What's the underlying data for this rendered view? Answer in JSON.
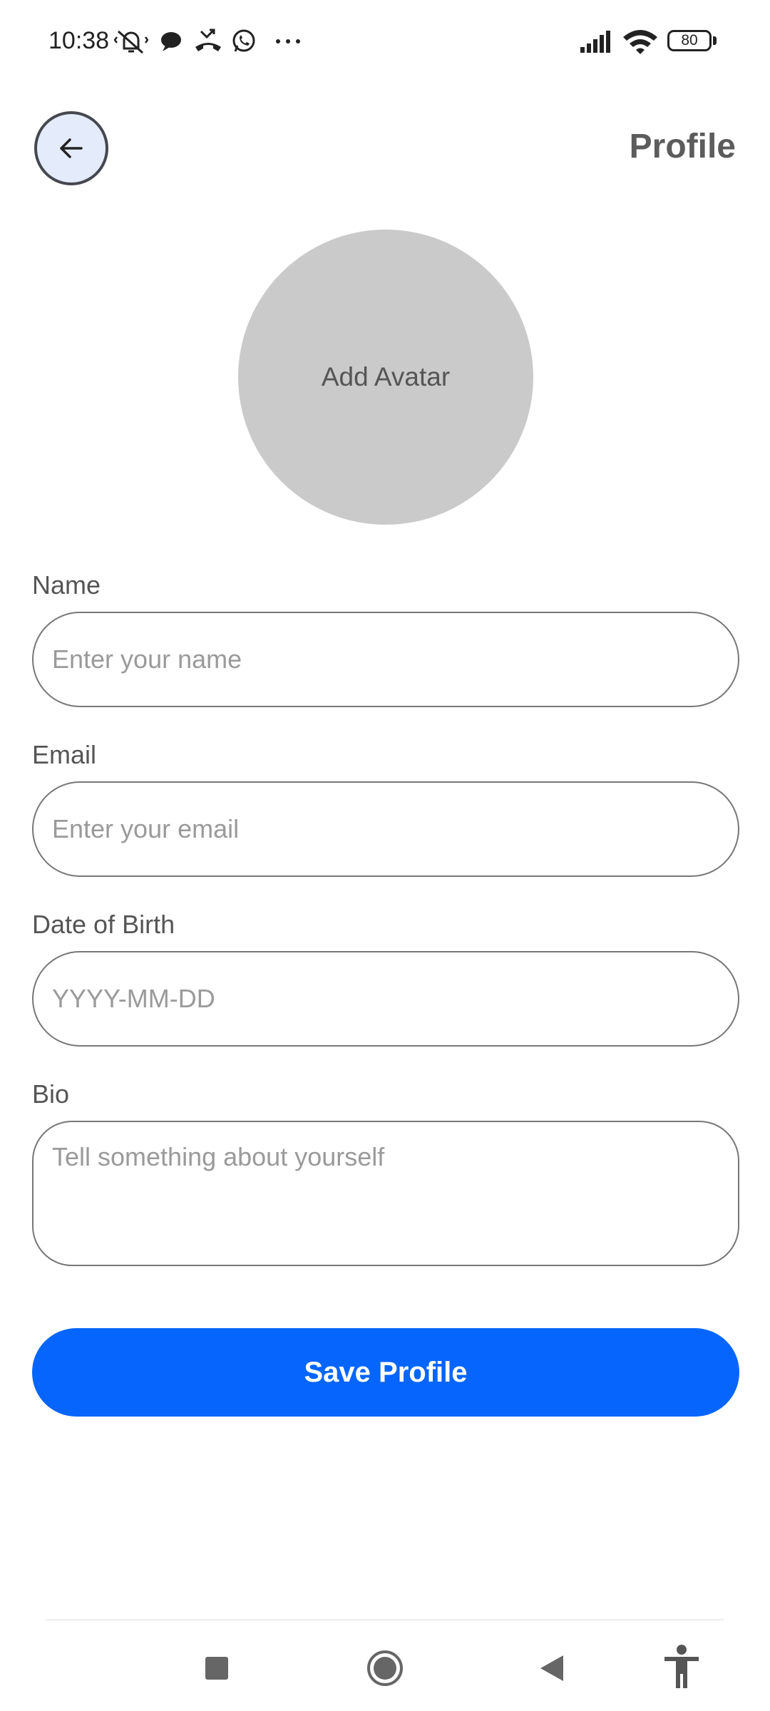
{
  "status_bar": {
    "time": "10:38",
    "notification_icons": [
      "mute-vibrate-icon",
      "chat-bubble-icon",
      "missed-call-icon",
      "whatsapp-icon",
      "more-dots-icon"
    ],
    "system_icons": [
      "signal-icon",
      "wifi-icon",
      "battery-icon"
    ],
    "battery_level": "80"
  },
  "header": {
    "back_icon": "arrow-left-icon",
    "title": "Profile"
  },
  "avatar": {
    "label": "Add Avatar"
  },
  "form": {
    "name": {
      "label": "Name",
      "placeholder": "Enter your name",
      "value": ""
    },
    "email": {
      "label": "Email",
      "placeholder": "Enter your email",
      "value": ""
    },
    "dob": {
      "label": "Date of Birth",
      "placeholder": "YYYY-MM-DD",
      "value": ""
    },
    "bio": {
      "label": "Bio",
      "placeholder": "Tell something about yourself",
      "value": ""
    },
    "save_label": "Save Profile"
  },
  "nav_bar": {
    "buttons": [
      "recents-square-icon",
      "home-circle-icon",
      "back-triangle-icon",
      "accessibility-icon"
    ]
  },
  "colors": {
    "primary_button": "#0565fc",
    "back_button_bg": "#e4ecfb",
    "avatar_bg": "#cacaca",
    "title_text": "#5c5c5c"
  }
}
